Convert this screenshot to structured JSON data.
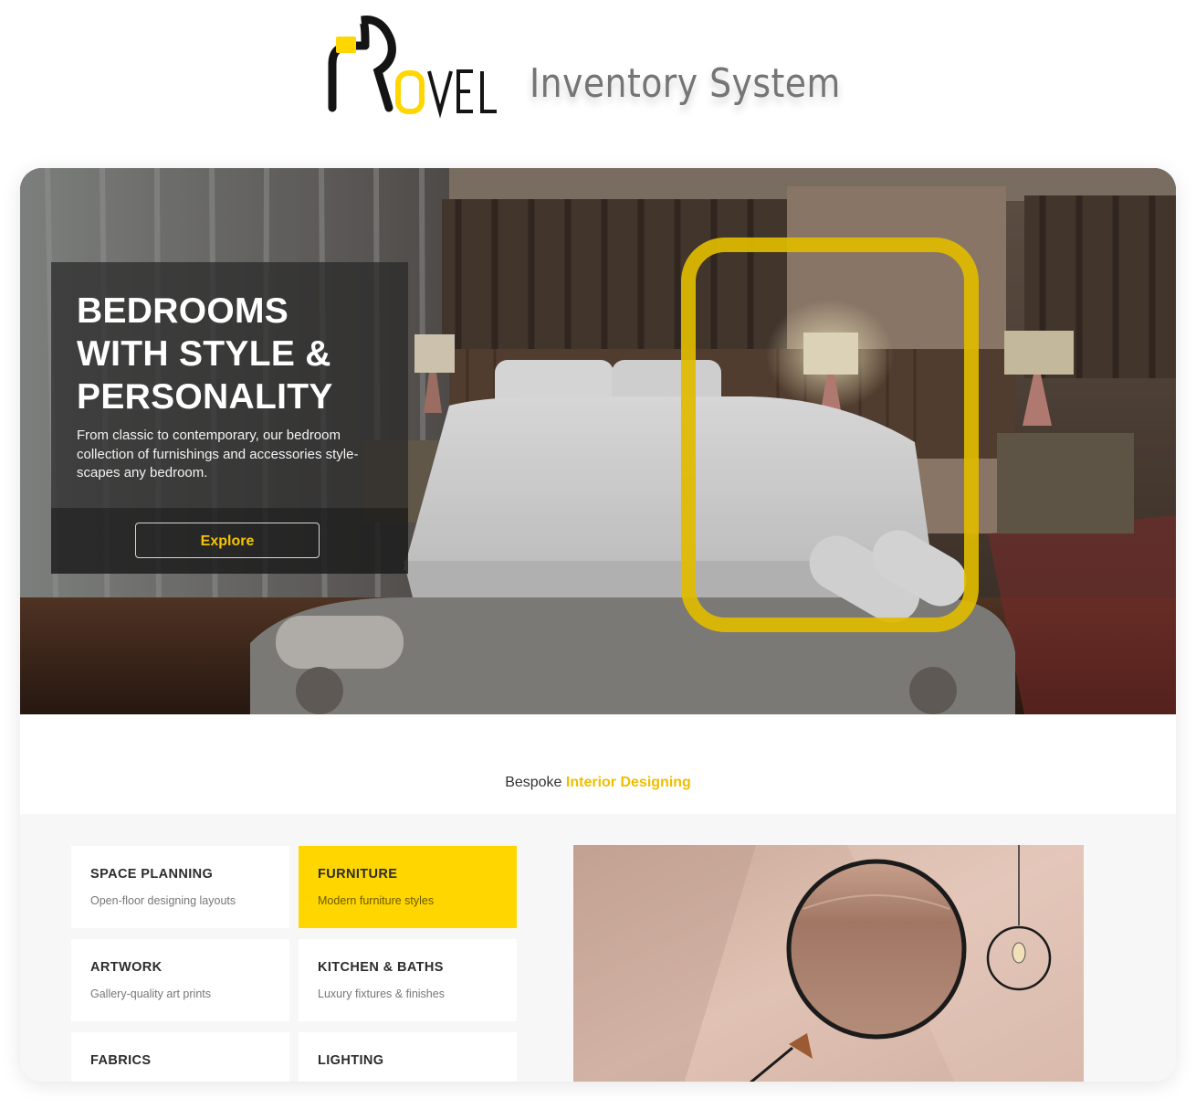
{
  "brand": {
    "logo_text": "ROVEL",
    "title": "Inventory System",
    "colors": {
      "accent": "#ffd600",
      "dark": "#1a1a1a",
      "title_gray": "#757575"
    }
  },
  "hero": {
    "title_lines": [
      "BEDROOMS",
      "WITH STYLE &",
      "PERSONALITY"
    ],
    "description": "From classic to contemporary, our bedroom collection of furnishings and accessories style-scapes any bedroom.",
    "button_label": "Explore"
  },
  "bespoke": {
    "prefix": "Bespoke",
    "highlight": "Interior Designing"
  },
  "services": [
    {
      "title": "SPACE PLANNING",
      "subtitle": "Open-floor designing layouts",
      "active": false
    },
    {
      "title": "FURNITURE",
      "subtitle": "Modern furniture styles",
      "active": true
    },
    {
      "title": "ARTWORK",
      "subtitle": "Gallery-quality art prints",
      "active": false
    },
    {
      "title": "KITCHEN & BATHS",
      "subtitle": "Luxury fixtures & finishes",
      "active": false
    },
    {
      "title": "FABRICS",
      "subtitle": "",
      "active": false
    },
    {
      "title": "LIGHTING",
      "subtitle": "",
      "active": false
    }
  ]
}
